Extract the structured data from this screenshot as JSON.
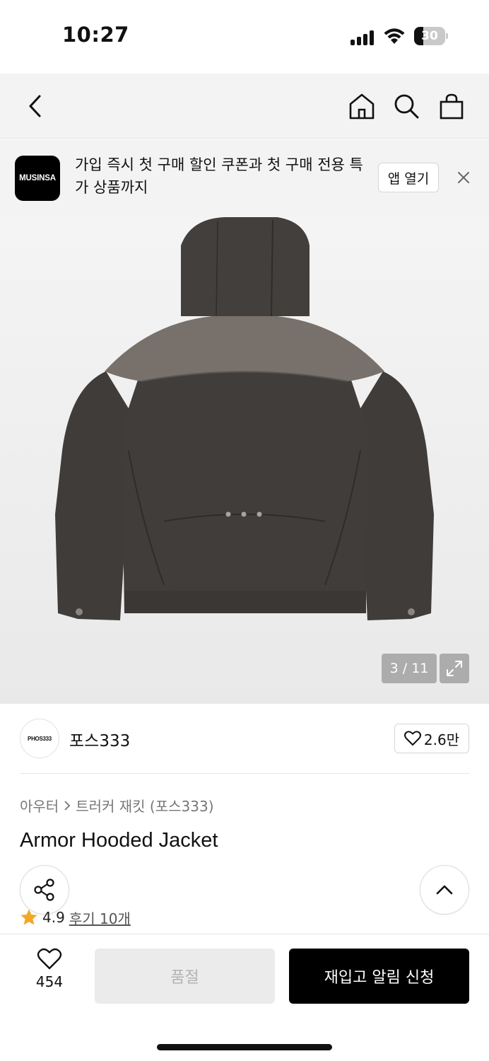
{
  "status_bar": {
    "time": "10:27",
    "battery": "30",
    "battery_level_pct": 30
  },
  "nav": {
    "icons": [
      "back-arrow-icon",
      "home-icon",
      "search-icon",
      "shopping-bag-icon"
    ]
  },
  "banner": {
    "logo_text": "MUSINSA",
    "message": "가입 즉시 첫 구매 할인 쿠폰과 첫 구매 전용 특가 상품까지",
    "open_app_label": "앱 열기",
    "close_icon": "close-icon"
  },
  "product_image": {
    "counter": "3 / 11",
    "expand_icon": "expand-icon"
  },
  "brand": {
    "logo_text": "PHOS333",
    "name": "포스333",
    "like_count": "2.6만"
  },
  "breadcrumb": {
    "category": "아우터",
    "subcategory": "트러커 재킷 (포스333)"
  },
  "product": {
    "title": "Armor Hooded Jacket",
    "rating": "4.9",
    "reviews_label": "후기 10개"
  },
  "bottom_bar": {
    "like_count": "454",
    "soldout_label": "품절",
    "restock_label": "재입고 알림 신청"
  },
  "colors": {
    "accent_star": "#f5a623",
    "primary_button": "#000000",
    "disabled_button": "#ebebeb"
  }
}
